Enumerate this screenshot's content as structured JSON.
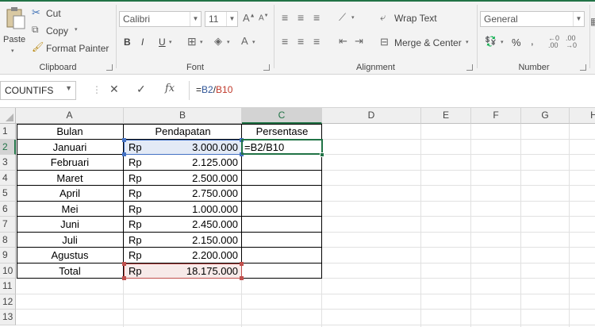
{
  "ribbon": {
    "clipboard": {
      "paste": "Paste",
      "cut": "Cut",
      "copy": "Copy",
      "format_painter": "Format Painter",
      "group_label": "Clipboard"
    },
    "font": {
      "font_name": "Calibri",
      "font_size": "11",
      "bold": "B",
      "italic": "I",
      "underline": "U",
      "group_label": "Font"
    },
    "alignment": {
      "wrap_text": "Wrap Text",
      "merge_center": "Merge & Center",
      "group_label": "Alignment"
    },
    "number": {
      "format": "General",
      "percent": "%",
      "comma": ",",
      "group_label": "Number"
    }
  },
  "formula_bar": {
    "name_box": "COUNTIFS",
    "cancel": "✕",
    "enter": "✓",
    "fx": "fx",
    "formula_eq": "=",
    "formula_ref1": "B2",
    "formula_op": "/",
    "formula_ref2": "B10"
  },
  "grid": {
    "columns": [
      "A",
      "B",
      "C",
      "D",
      "E",
      "F",
      "G",
      "H"
    ],
    "rows": [
      "1",
      "2",
      "3",
      "4",
      "5",
      "6",
      "7",
      "8",
      "9",
      "10",
      "11",
      "12",
      "13"
    ],
    "headers": {
      "a": "Bulan",
      "b": "Pendapatan",
      "c": "Persentase"
    },
    "data": [
      {
        "bulan": "Januari",
        "rp": "Rp",
        "amount": "3.000.000",
        "pct": "=B2/B10"
      },
      {
        "bulan": "Februari",
        "rp": "Rp",
        "amount": "2.125.000",
        "pct": ""
      },
      {
        "bulan": "Maret",
        "rp": "Rp",
        "amount": "2.500.000",
        "pct": ""
      },
      {
        "bulan": "April",
        "rp": "Rp",
        "amount": "2.750.000",
        "pct": ""
      },
      {
        "bulan": "Mei",
        "rp": "Rp",
        "amount": "1.000.000",
        "pct": ""
      },
      {
        "bulan": "Juni",
        "rp": "Rp",
        "amount": "2.450.000",
        "pct": ""
      },
      {
        "bulan": "Juli",
        "rp": "Rp",
        "amount": "2.150.000",
        "pct": ""
      },
      {
        "bulan": "Agustus",
        "rp": "Rp",
        "amount": "2.200.000",
        "pct": ""
      },
      {
        "bulan": "Total",
        "rp": "Rp",
        "amount": "18.175.000",
        "pct": ""
      }
    ]
  },
  "colors": {
    "accent": "#217346",
    "ref_blue": "#4472c4",
    "ref_red": "#c0504d"
  }
}
